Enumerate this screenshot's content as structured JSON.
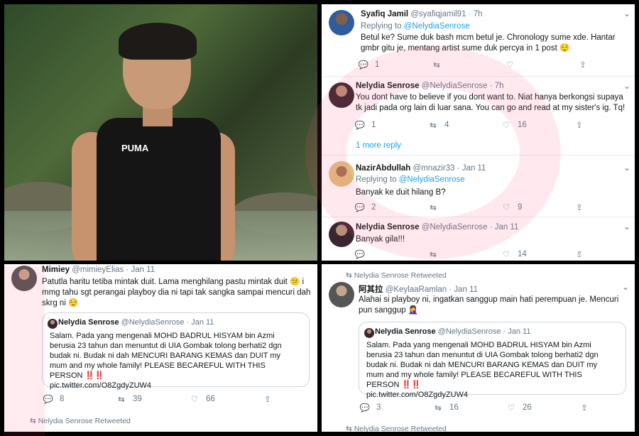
{
  "collage": {
    "photo": {
      "shirt_logo": "PUMA"
    },
    "thread_top": {
      "tweets": [
        {
          "display_name": "Syafiq Jamil",
          "handle": "@syafiqjamil91",
          "time": "· 7h",
          "replying_to_label": "Replying to",
          "replying_to_handle": "@NelydiaSenrose",
          "text": "Betul ke? Sume duk bash mcm betul je. Chronology sume xde. Hantar gmbr gitu je, mentang artist sume duk percya in 1 post 😌",
          "replies": "1",
          "retweets": "",
          "likes": "",
          "share": ""
        },
        {
          "display_name": "Nelydia Senrose",
          "handle": "@NelydiaSenrose",
          "time": "· 7h",
          "text": "You dont have to believe if you dont want to. Niat hanya berkongsi supaya tk jadi pada org lain di luar sana. You can go and read at my sister's ig. Tq!",
          "replies": "1",
          "retweets": "4",
          "likes": "16",
          "more_replies": "1 more reply"
        },
        {
          "display_name": "NazirAbdullah",
          "handle": "@mnazir33",
          "time": "· Jan 11",
          "replying_to_label": "Replying to",
          "replying_to_handle": "@NelydiaSenrose",
          "text": "Banyak ke duit hilang B?",
          "replies": "2",
          "retweets": "",
          "likes": "9"
        },
        {
          "display_name": "Nelydia Senrose",
          "handle": "@NelydiaSenrose",
          "time": "· Jan 11",
          "text": "Banyak gila!!!",
          "replies": "",
          "retweets": "",
          "likes": "14"
        }
      ]
    },
    "quote_tweet_left": {
      "display_name": "Mimiey",
      "handle": "@mimieyElias",
      "time": "· Jan 11",
      "text": "Patutla haritu tetiba mintak duit. Lama menghilang pastu mintak duit 😕 i mmg tahu sgt perangai playboy dia ni tapi tak sangka sampai mencuri dah skrg ni 😌",
      "quote": {
        "display_name": "Nelydia Senrose",
        "handle": "@NelydiaSenrose",
        "time": "· Jan 11",
        "text": "Salam. Pada yang mengenali MOHD BADRUL HISYAM bin Azmi berusia 23 tahun dan menuntut di UIA Gombak tolong berhati2 dgn budak ni. Budak ni dah MENCURI BARANG KEMAS dan DUIT my mum and my whole family! PLEASE BECAREFUL WITH THIS PERSON",
        "alarm": "‼️‼️",
        "link": "pic.twitter.com/O8ZgdyZUW4"
      },
      "replies": "8",
      "retweets": "39",
      "likes": "66",
      "retweeted_label": "Nelydia Senrose Retweeted"
    },
    "quote_tweet_right": {
      "retweeted_label": "Nelydia Senrose Retweeted",
      "display_name": "阿其拉",
      "handle": "@KeylaaRamlan",
      "time": "· Jan 11",
      "text": "Alahai si playboy ni, ingatkan sanggup main hati perempuan je. Mencuri pun sanggup 🤦‍♀️",
      "quote": {
        "display_name": "Nelydia Senrose",
        "handle": "@NelydiaSenrose",
        "time": "· Jan 11",
        "text": "Salam. Pada yang mengenali MOHD BADRUL HISYAM bin Azmi berusia 23 tahun dan menuntut di UIA Gombak tolong berhati2 dgn budak ni. Budak ni dah MENCURI BARANG KEMAS dan DUIT my mum and my whole family! PLEASE BECAREFUL WITH THIS PERSON",
        "alarm": "‼️‼️",
        "link": "pic.twitter.com/O8ZgdyZUW4"
      },
      "replies": "3",
      "retweets": "16",
      "likes": "26",
      "footer_retweeted_label": "Nelydia Senrose Retweeted"
    }
  }
}
